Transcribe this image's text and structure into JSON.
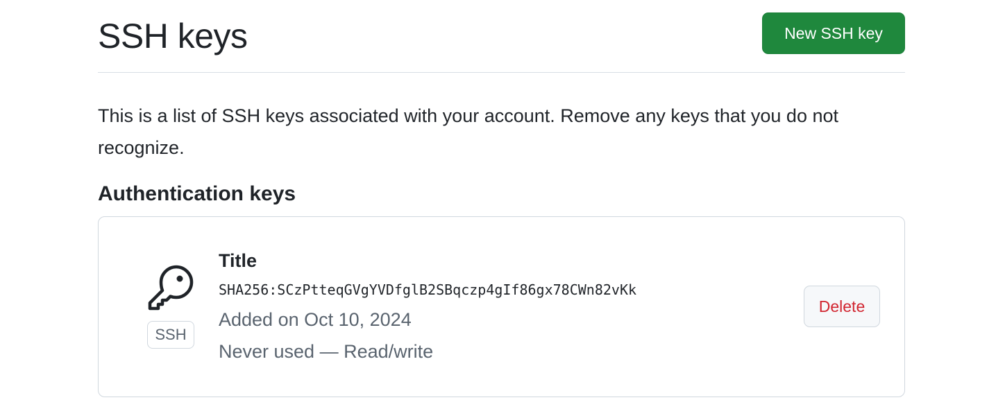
{
  "header": {
    "title": "SSH keys",
    "new_key_label": "New SSH key"
  },
  "description": "This is a list of SSH keys associated with your account. Remove any keys that you do not recognize.",
  "section": {
    "heading": "Authentication keys"
  },
  "keys": [
    {
      "icon": "key-icon",
      "badge": "SSH",
      "title": "Title",
      "fingerprint": "SHA256:SCzPtteqGVgYVDfglB2SBqczp4gIf86gx78CWn82vKk",
      "added": "Added on Oct 10, 2024",
      "usage": "Never used — Read/write",
      "delete_label": "Delete"
    }
  ],
  "colors": {
    "primary_button": "#1f883d",
    "danger_text": "#d1242f",
    "muted_text": "#59636e",
    "border": "#d0d7de"
  }
}
